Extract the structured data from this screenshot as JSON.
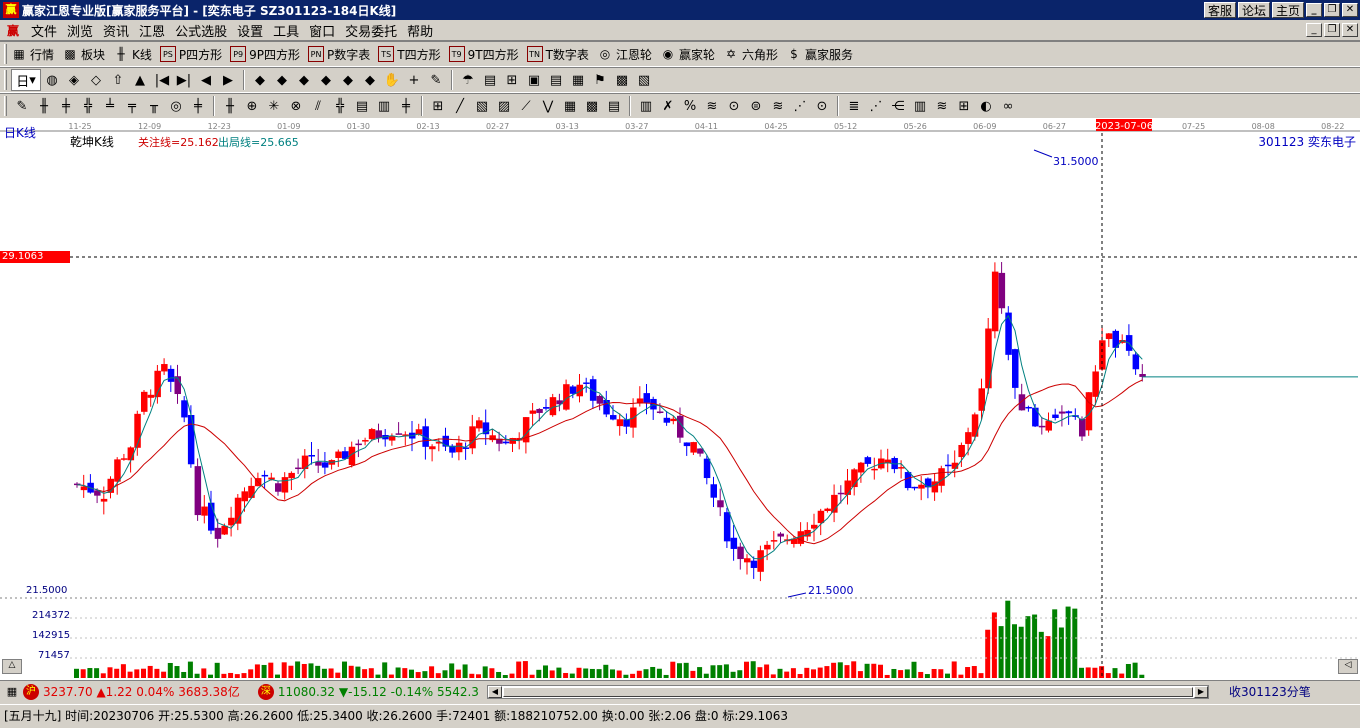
{
  "window": {
    "app_icon": "赢",
    "title": "赢家江恩专业版[赢家服务平台] - [奕东电子   SZ301123-184日K线]",
    "links": [
      "客服",
      "论坛",
      "主页"
    ],
    "controls": [
      "_",
      "❐",
      "✕"
    ]
  },
  "menu": {
    "logo": "赢",
    "items": [
      "文件",
      "浏览",
      "资讯",
      "江恩",
      "公式选股",
      "设置",
      "工具",
      "窗口",
      "交易委托",
      "帮助"
    ],
    "controls": [
      "_",
      "❐",
      "✕"
    ]
  },
  "toolbar1": {
    "items": [
      {
        "icon": "table-icon",
        "glyph": "▦",
        "label": "行情"
      },
      {
        "icon": "blocks-icon",
        "glyph": "▩",
        "label": "板块"
      },
      {
        "icon": "kline-icon",
        "glyph": "╫",
        "label": "K线"
      },
      {
        "icon": "ps-icon",
        "glyph": "PS",
        "label": "P四方形"
      },
      {
        "icon": "p9-icon",
        "glyph": "P9",
        "label": "9P四方形"
      },
      {
        "icon": "pn-icon",
        "glyph": "PN",
        "label": "P数字表"
      },
      {
        "icon": "ts-icon",
        "glyph": "TS",
        "label": "T四方形"
      },
      {
        "icon": "t9-icon",
        "glyph": "T9",
        "label": "9T四方形"
      },
      {
        "icon": "tn-icon",
        "glyph": "TN",
        "label": "T数字表"
      },
      {
        "icon": "gann-wheel-icon",
        "glyph": "◎",
        "label": "江恩轮"
      },
      {
        "icon": "winner-wheel-icon",
        "glyph": "◉",
        "label": "赢家轮"
      },
      {
        "icon": "hexagon-icon",
        "glyph": "✡",
        "label": "六角形"
      },
      {
        "icon": "service-icon",
        "glyph": "$",
        "label": "赢家服务"
      }
    ]
  },
  "toolbar2": {
    "period": "日",
    "icons": [
      "◍",
      "◈",
      "◇",
      "⇧",
      "▲",
      "|◀",
      "▶|",
      "◀",
      "▶",
      "◆",
      "◆",
      "◆",
      "◆",
      "◆",
      "◆",
      "✋",
      "+",
      "✎",
      "☂",
      "▤",
      "⊞",
      "▣",
      "▤",
      "▦",
      "⚑",
      "▩",
      "▧"
    ]
  },
  "toolbar3": {
    "icons": [
      "✎",
      "╫",
      "╪",
      "╬",
      "╧",
      "╤",
      "╥",
      "◎",
      "╪",
      "╫",
      "⊕",
      "✳",
      "⊗",
      "⫽",
      "╬",
      "▤",
      "▥",
      "╪",
      "⊞",
      "╱",
      "▧",
      "▨",
      "⟋",
      "⋁",
      "▦",
      "▩",
      "▤",
      "▥",
      "✗",
      "%",
      "≋",
      "⊙",
      "⊜",
      "≋",
      "⋰",
      "⊙",
      "≣",
      "⋰",
      "⋲",
      "▥",
      "≋",
      "⊞",
      "◐",
      "∞"
    ]
  },
  "chart_data": {
    "type": "candlestick",
    "period_label": "日K线",
    "indicator_name": "乾坤K线",
    "focus_line_label": "关注线=25.162",
    "exit_line_label": "出局线=25.665",
    "stock_label": "301123  奕东电子",
    "x_ticks": [
      "11-25",
      "12-09",
      "12-23",
      "01-09",
      "01-30",
      "02-13",
      "02-27",
      "03-13",
      "03-27",
      "04-11",
      "04-25",
      "05-12",
      "05-26",
      "06-09",
      "06-27",
      "2023-07-06",
      "07-25",
      "08-08",
      "08-22"
    ],
    "cursor_date": "2023-07-06",
    "price_marker": "29.1063",
    "high_label": "31.5000",
    "low_label": "21.5000",
    "low_axis_label": "21.5000",
    "ylim": [
      21.5,
      31.5
    ],
    "volume_ticks": [
      "214372",
      "142915",
      "71457"
    ],
    "colors": {
      "up": "#ff0000",
      "down": "#0000ff",
      "neutral": "#800080",
      "focus": "#cc0000",
      "exit": "#008080",
      "vol_up": "#ff0000",
      "vol_down": "#008000"
    }
  },
  "status": {
    "sh_icon": "沪",
    "sh_value": "3237.70",
    "sh_change": "▲1.22",
    "sh_pct": "0.04%",
    "sh_amount": "3683.38亿",
    "sz_icon": "深",
    "sz_value": "11080.32",
    "sz_change": "▼-15.12",
    "sz_pct": "-0.14%",
    "sz_amount": "5542.3",
    "right_label": "收301123分笔"
  },
  "infobar": {
    "text": "[五月十九] 时间:20230706 开:25.5300 高:26.2600 低:25.3400 收:26.2600 手:72401 额:188210752.00 换:0.00 张:2.06 盘:0 标:29.1063"
  }
}
